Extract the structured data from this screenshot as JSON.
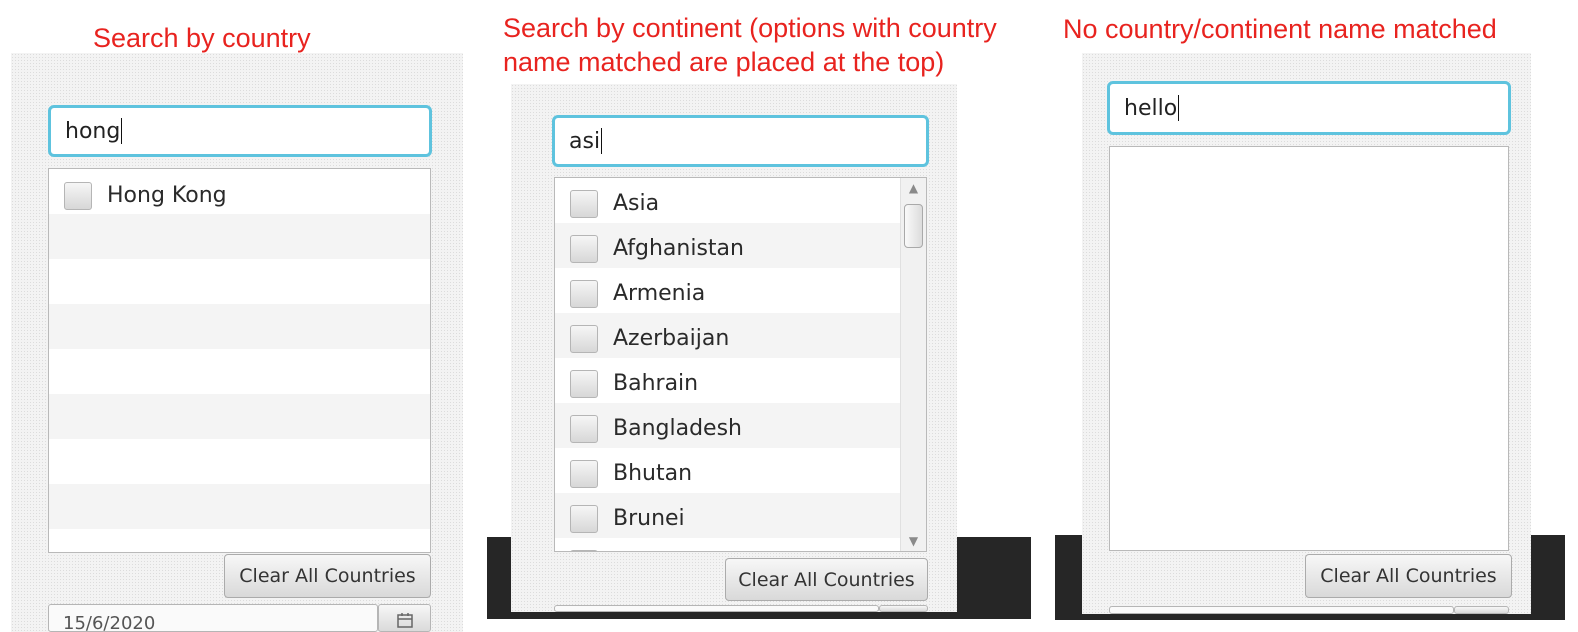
{
  "captions": {
    "panel1": "Search by country",
    "panel2_line1": "Search by continent (options with country",
    "panel2_line2": "name matched are placed at the top)",
    "panel3": "No country/continent name matched"
  },
  "panel1": {
    "search_value": "hong",
    "items": [
      {
        "label": "Hong Kong",
        "checked": false
      }
    ],
    "clear_button_label": "Clear All Countries",
    "date_field_value": "15/6/2020"
  },
  "panel2": {
    "search_value": "asi",
    "items": [
      {
        "label": "Asia",
        "checked": false
      },
      {
        "label": "Afghanistan",
        "checked": false
      },
      {
        "label": "Armenia",
        "checked": false
      },
      {
        "label": "Azerbaijan",
        "checked": false
      },
      {
        "label": "Bahrain",
        "checked": false
      },
      {
        "label": "Bangladesh",
        "checked": false
      },
      {
        "label": "Bhutan",
        "checked": false
      },
      {
        "label": "Brunei",
        "checked": false
      }
    ],
    "clear_button_label": "Clear All Countries"
  },
  "panel3": {
    "search_value": "hello",
    "items": [],
    "clear_button_label": "Clear All Countries"
  },
  "icons": {
    "scroll_up": "chevron-up-icon",
    "scroll_down": "chevron-down-icon",
    "calendar": "calendar-icon"
  },
  "colors": {
    "caption": "#e8231f",
    "focus_border": "#5ec3de"
  }
}
